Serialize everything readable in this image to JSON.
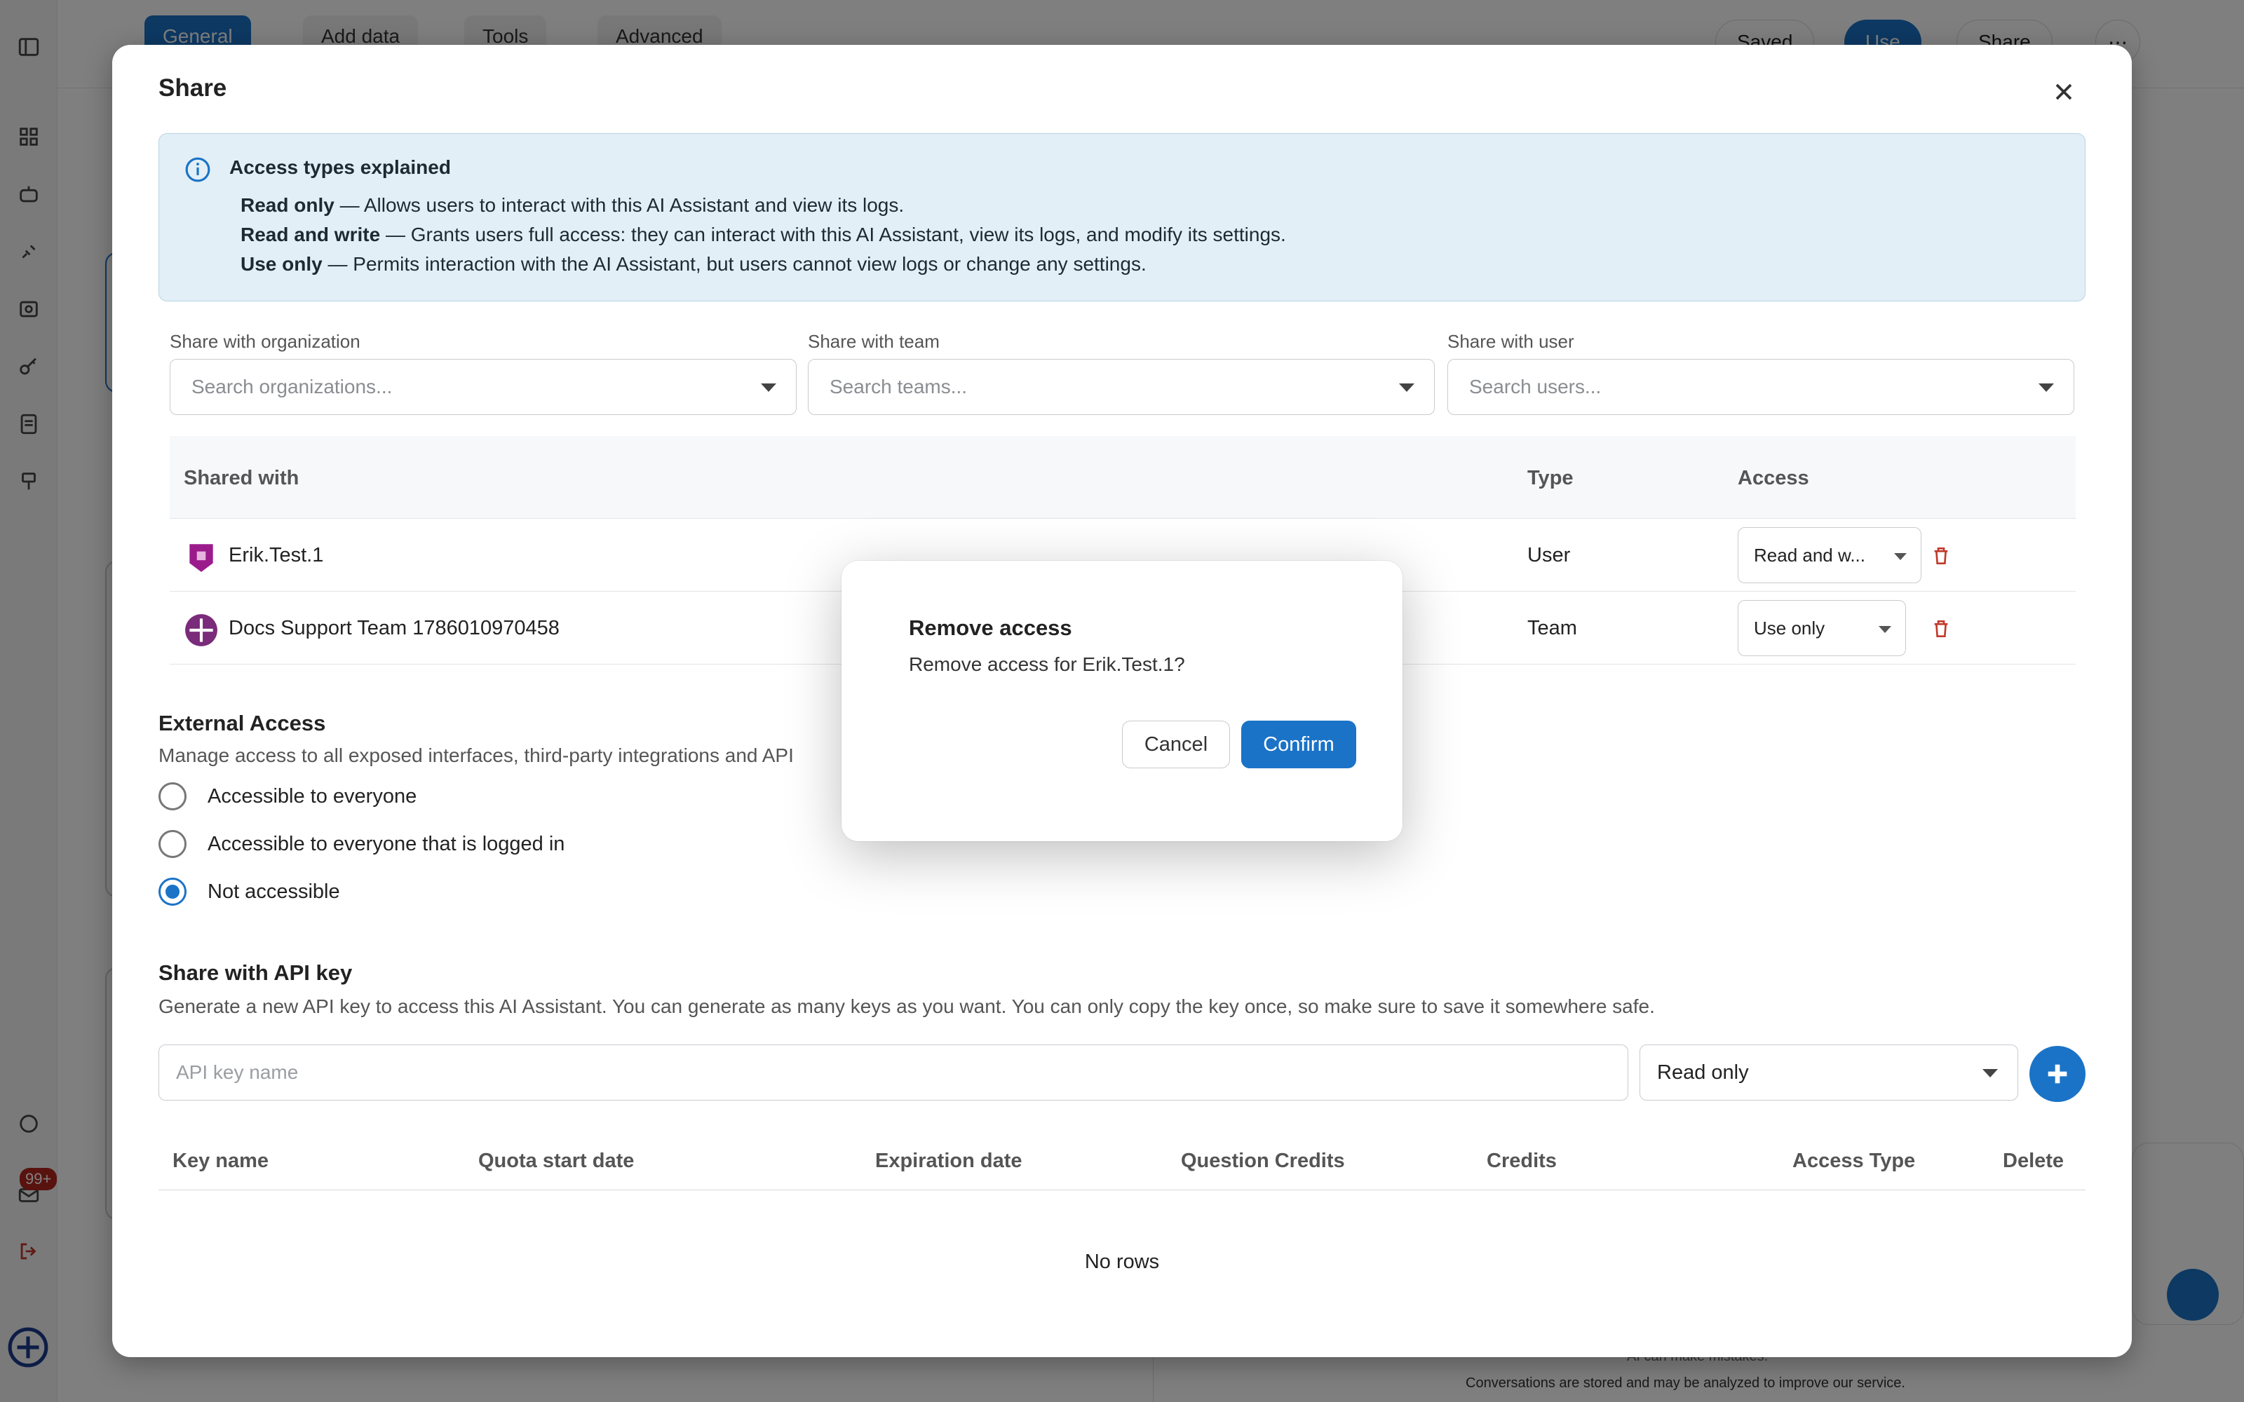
{
  "background": {
    "tabs": [
      "General",
      "Add data",
      "Tools",
      "Advanced"
    ],
    "buttons": {
      "saved": "Saved",
      "use": "Use",
      "share": "Share"
    },
    "notification_badge": "99+",
    "footer": "Conversations are stored and may be analyzed to improve our service.",
    "footer_partial": "AI can make mistakes."
  },
  "share_modal": {
    "title": "Share",
    "info": {
      "title": "Access types explained",
      "lines": [
        {
          "term": "Read only",
          "desc": " — Allows users to interact with this AI Assistant and view its logs."
        },
        {
          "term": "Read and write",
          "desc": " — Grants users full access: they can interact with this AI Assistant, view its logs, and modify its settings."
        },
        {
          "term": "Use only",
          "desc": " — Permits interaction with the AI Assistant, but users cannot view logs or change any settings."
        }
      ]
    },
    "fields": [
      {
        "label": "Share with organization",
        "placeholder": "Search organizations..."
      },
      {
        "label": "Share with team",
        "placeholder": "Search teams..."
      },
      {
        "label": "Share with user",
        "placeholder": "Search users..."
      }
    ],
    "table": {
      "headers": {
        "shared_with": "Shared with",
        "type": "Type",
        "access": "Access"
      },
      "rows": [
        {
          "name": "Erik.Test.1",
          "type": "User",
          "access": "Read and w..."
        },
        {
          "name": "Docs Support Team 1786010970458",
          "type": "Team",
          "access": "Use only"
        }
      ]
    },
    "external_access": {
      "title": "External Access",
      "description": "Manage access to all exposed interfaces, third-party integrations and API",
      "options": [
        "Accessible to everyone",
        "Accessible to everyone that is logged in",
        "Not accessible"
      ],
      "selected": "Not accessible"
    },
    "api_key": {
      "title": "Share with API key",
      "description": "Generate a new API key to access this AI Assistant. You can generate as many keys as you want. You can only copy the key once, so make sure to save it somewhere safe.",
      "name_placeholder": "API key name",
      "access_value": "Read only",
      "columns": [
        "Key name",
        "Quota start date",
        "Expiration date",
        "Question Credits",
        "Credits",
        "Access Type",
        "Delete"
      ],
      "empty_text": "No rows"
    }
  },
  "confirm_dialog": {
    "title": "Remove access",
    "message": "Remove access for Erik.Test.1?",
    "cancel_label": "Cancel",
    "confirm_label": "Confirm"
  },
  "colors": {
    "accent": "#1a73c7",
    "danger": "#c0392b",
    "info_bg": "#e2eff6",
    "avatar_user": "#9c1b8c",
    "avatar_team": "#7a2b7a"
  }
}
